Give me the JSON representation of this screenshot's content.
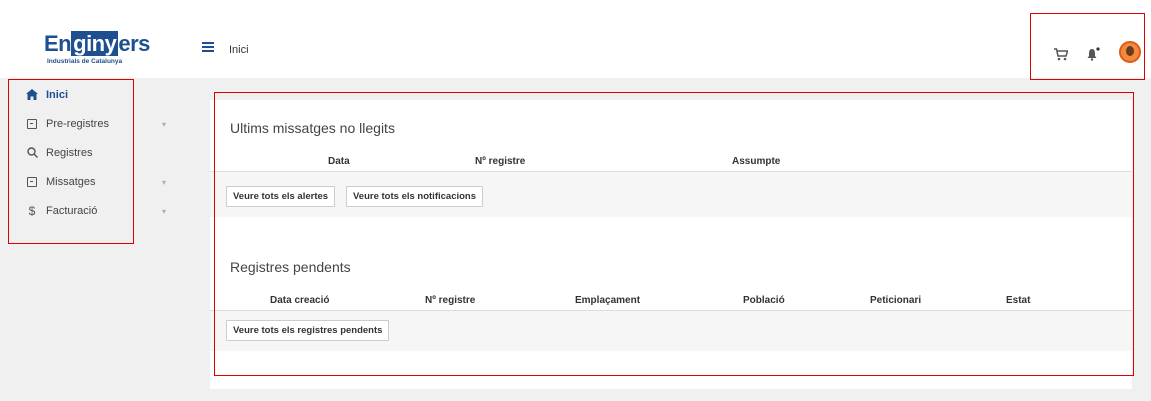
{
  "logo": {
    "part1": "En",
    "part2": "giny",
    "part3": "ers",
    "subtitle": "Industrials de Catalunya"
  },
  "header": {
    "title": "Inici",
    "icons": [
      "menu-icon",
      "cart-icon",
      "bell-icon",
      "avatar"
    ]
  },
  "sidebar": {
    "items": [
      {
        "label": "Inici",
        "icon": "home-icon",
        "active": true
      },
      {
        "label": "Pre-registres",
        "icon": "inbox-icon",
        "chevron": "▾"
      },
      {
        "label": "Registres",
        "icon": "search-icon"
      },
      {
        "label": "Missatges",
        "icon": "inbox-icon",
        "chevron": "▾"
      },
      {
        "label": "Facturació",
        "icon": "dollar-icon",
        "chevron": "▾"
      }
    ]
  },
  "messages": {
    "title": "Ultims missatges no llegits",
    "columns": [
      "Data",
      "Nº registre",
      "Assumpte"
    ],
    "buttons": [
      "Veure tots els alertes",
      "Veure tots els notificacions"
    ]
  },
  "pending": {
    "title": "Registres pendents",
    "columns": [
      "Data creació",
      "Nº registre",
      "Emplaçament",
      "Població",
      "Peticionari",
      "Estat"
    ],
    "button": "Veure tots els registres pendents"
  },
  "colors": {
    "brand": "#1d4f91",
    "highlight": "#e00000",
    "background": "#f0f0f0"
  }
}
